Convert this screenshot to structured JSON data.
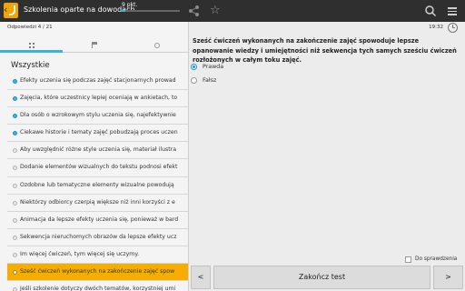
{
  "header": {
    "title": "Szkolenia oparte na dowodach",
    "points": "9 pkt.",
    "progress_fraction": 0.07,
    "accent": "#33b5e5",
    "icons": [
      "back-icon",
      "app-logo",
      "share-icon",
      "star-icon",
      "search-icon",
      "menu-icon"
    ]
  },
  "left": {
    "answered": "Odpowiedzi  4 / 21",
    "tabs": [
      "grid-icon",
      "flag-icon",
      "circle-icon"
    ],
    "section_title": "Wszystkie",
    "questions": [
      {
        "text": "Efekty uczenia się podczas zajęć stacjonarnych prowad",
        "answered": true
      },
      {
        "text": "Zajęcia, które uczestnicy lepiej oceniają w ankietach, to",
        "answered": true
      },
      {
        "text": "Dla osób o wzrokowym stylu uczenia się, najefektywnie",
        "answered": true
      },
      {
        "text": "Ciekawe historie i tematy zajęć pobudzają proces uczen",
        "answered": true
      },
      {
        "text": "Aby uwzględnić różne style uczenia się, materiał ilustra",
        "answered": false
      },
      {
        "text": "Dodanie elementów wizualnych do tekstu podnosi efekt",
        "answered": false
      },
      {
        "text": "Ozdobne lub tematyczne elementy wizualne powodują",
        "answered": false
      },
      {
        "text": "Niektórzy odbiorcy czerpią większe niż inni korzyści z e",
        "answered": false
      },
      {
        "text": "Animacja da lepsze efekty uczenia się, ponieważ w bard",
        "answered": false
      },
      {
        "text": "Sekwencja nieruchomych obrazów da lepsze efekty ucz",
        "answered": false
      },
      {
        "text": "Im więcej ćwiczeń, tym więcej się uczymy.",
        "answered": false
      },
      {
        "text": "Sześć ćwiczeń wykonanych na zakończenie zajęć spow",
        "answered": false,
        "selected": true
      },
      {
        "text": "Jeśli szkolenie dotyczy dwóch tematów, korzystniej umi",
        "answered": false
      }
    ]
  },
  "right": {
    "time": "19:32",
    "question": "Sześć ćwiczeń wykonanych na zakończenie zajęć spowoduje lepsze opanowanie wiedzy i umiejętności niż sekwencja tych samych sześciu ćwiczeń rozłożonych w całym toku zajęć.",
    "options": [
      {
        "label": "Prawda",
        "checked": true
      },
      {
        "label": "Fałsz",
        "checked": false
      }
    ],
    "verify_label": "Do sprawdzenia",
    "prev_label": "<",
    "finish_label": "Zakończ test",
    "next_label": ">"
  }
}
